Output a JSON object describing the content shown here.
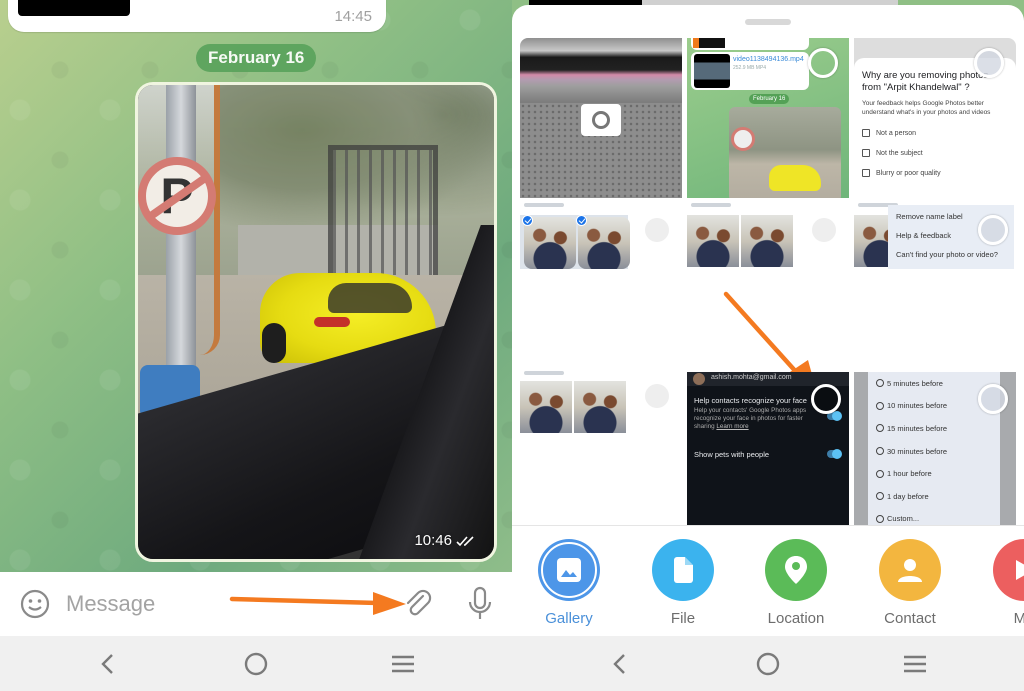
{
  "left": {
    "previous_message": {
      "time": "14:45"
    },
    "date_separator": "February 16",
    "photo_message": {
      "time": "10:46",
      "status": "read-double-check"
    },
    "composer": {
      "placeholder": "Message",
      "icons": {
        "emoji": "emoji-icon",
        "attach": "paperclip-icon",
        "mic": "microphone-icon"
      }
    },
    "annotation": {
      "type": "arrow",
      "color": "#f47a20",
      "points_to": "paperclip-icon"
    },
    "navbar": {
      "back": "back-icon",
      "home": "home-icon",
      "recents": "recents-icon"
    }
  },
  "right": {
    "gallery_grid": {
      "tiles": [
        {
          "kind": "camera",
          "icon": "camera-icon"
        },
        {
          "kind": "telegram-screenshot",
          "file_name": "video1138494136.mp4",
          "file_size": "252.9 MB MP4",
          "date_chip": "February 16"
        },
        {
          "kind": "photos-feedback-dialog",
          "title": "Why are you removing photos from \"Arpit Khandelwal\" ?",
          "subtitle": "Your feedback helps Google Photos better understand what's in your photos and videos",
          "options": [
            "Not a person",
            "Not the subject",
            "Blurry or poor quality"
          ]
        },
        {
          "kind": "faces-selected"
        },
        {
          "kind": "faces"
        },
        {
          "kind": "photos-menu",
          "menu_items": [
            "Remove name label",
            "Help & feedback",
            "Can't find your photo or video?"
          ]
        },
        {
          "kind": "faces"
        },
        {
          "kind": "face-settings-dark",
          "email": "ashish.mohta@gmail.com",
          "setting_title": "Help contacts recognize your face",
          "setting_desc": "Help your contacts' Google Photos apps recognize your face in photos for faster sharing",
          "learn_more": "Learn more",
          "pets_label": "Show pets with people",
          "help_contacts_enabled": true,
          "pets_enabled": true
        },
        {
          "kind": "reminder-options",
          "options": [
            "5 minutes before",
            "10 minutes before",
            "15 minutes before",
            "30 minutes before",
            "1 hour before",
            "1 day before",
            "Custom..."
          ]
        }
      ]
    },
    "annotation": {
      "type": "arrow",
      "color": "#f47a20",
      "points_to": "tile-8-select-circle"
    },
    "attach_menu": [
      {
        "label": "Gallery",
        "icon": "gallery-icon",
        "color": "#4d96e8",
        "selected": true
      },
      {
        "label": "File",
        "icon": "file-icon",
        "color": "#3bb3ee",
        "selected": false
      },
      {
        "label": "Location",
        "icon": "location-pin-icon",
        "color": "#5bbb58",
        "selected": false
      },
      {
        "label": "Contact",
        "icon": "contact-icon",
        "color": "#f3b63f",
        "selected": false
      },
      {
        "label": "Mu",
        "icon": "music-icon",
        "color": "#ec5f5f",
        "selected": false
      }
    ],
    "navbar": {
      "back": "back-icon",
      "home": "home-icon",
      "recents": "recents-icon"
    }
  }
}
